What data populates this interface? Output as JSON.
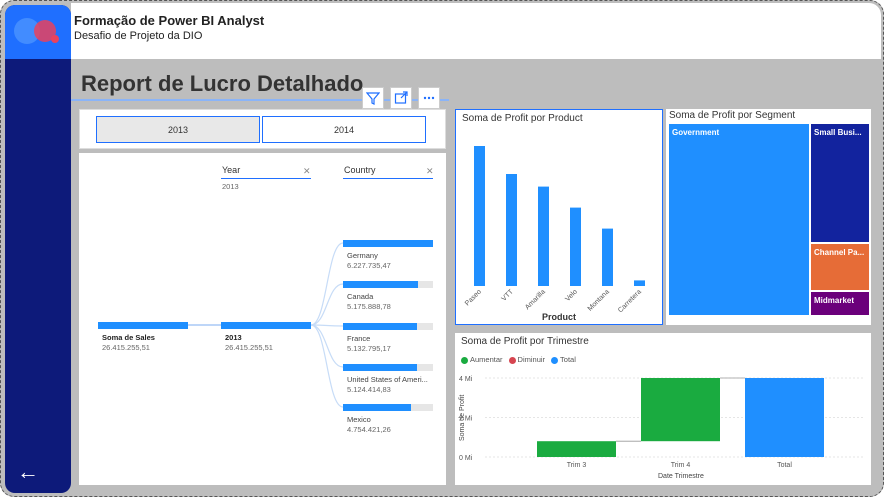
{
  "header": {
    "title": "Formação de Power BI Analyst",
    "subtitle": "Desafio de Projeto da DIO"
  },
  "report_title": "Report de Lucro Detalhado",
  "slicer": {
    "options": [
      "2013",
      "2014"
    ]
  },
  "decomp": {
    "year_header": "Year",
    "year_filter": "2013",
    "country_header": "Country",
    "root": {
      "label": "Soma de Sales",
      "value": "26.415.255,51"
    },
    "year_node": {
      "label": "2013",
      "value": "26.415.255,51"
    },
    "countries": [
      {
        "label": "Germany",
        "value": "6.227.735,47",
        "frac": 1.0
      },
      {
        "label": "Canada",
        "value": "5.175.888,78",
        "frac": 0.83
      },
      {
        "label": "France",
        "value": "5.132.795,17",
        "frac": 0.82
      },
      {
        "label": "United States of Ameri...",
        "value": "5.124.414,83",
        "frac": 0.82
      },
      {
        "label": "Mexico",
        "value": "4.754.421,26",
        "frac": 0.76
      }
    ]
  },
  "chart_data": [
    {
      "type": "bar",
      "title": "Soma de Profit por Product",
      "xlabel": "Product",
      "categories": [
        "Paseo",
        "VTT",
        "Amarilla",
        "Velo",
        "Montana",
        "Carretera"
      ],
      "values": [
        100,
        80,
        71,
        56,
        41,
        4
      ],
      "color": "#1f8fff"
    },
    {
      "type": "treemap",
      "title": "Soma de Profit por Segment",
      "items": [
        {
          "label": "Government",
          "color": "#1f8fff"
        },
        {
          "label": "Small Busi...",
          "color": "#12239e"
        },
        {
          "label": "Channel Pa...",
          "color": "#e66c37"
        },
        {
          "label": "Midmarket",
          "color": "#6b007b"
        }
      ]
    },
    {
      "type": "waterfall",
      "title": "Soma de Profit por Trimestre",
      "xlabel": "Date Trimestre",
      "ylabel": "Soma de Profit",
      "legend": [
        {
          "label": "Aumentar",
          "color": "#1aab40"
        },
        {
          "label": "Diminuir",
          "color": "#d64550"
        },
        {
          "label": "Total",
          "color": "#1f8fff"
        }
      ],
      "y_ticks": [
        "4 Mi",
        "2 Mi",
        "0 Mi"
      ],
      "ylim": [
        0,
        4
      ],
      "categories": [
        "Trim 3",
        "Trim 4",
        "Total"
      ],
      "steps": [
        {
          "start": 0,
          "end": 0.8,
          "kind": "increase"
        },
        {
          "start": 0.8,
          "end": 4.0,
          "kind": "increase"
        },
        {
          "start": 0,
          "end": 4.0,
          "kind": "total"
        }
      ]
    }
  ]
}
